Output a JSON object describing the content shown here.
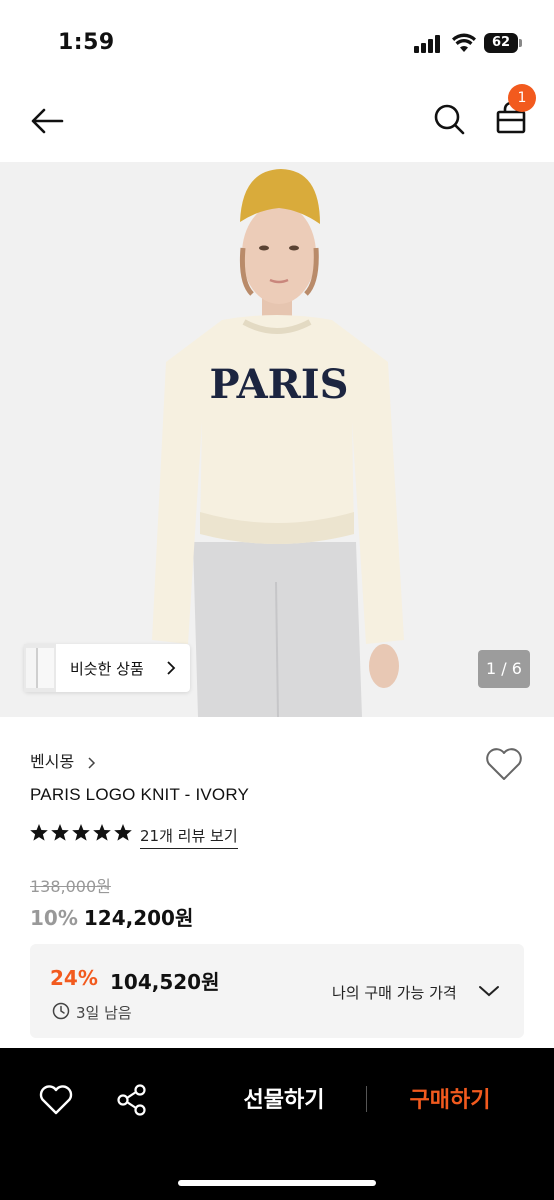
{
  "status_bar": {
    "time": "1:59",
    "battery": "62"
  },
  "nav": {
    "cart_count": "1"
  },
  "gallery": {
    "similar_label": "비슷한 상품",
    "page_indicator": "1 / 6",
    "hero_text": "PARIS"
  },
  "product": {
    "brand": "벤시몽",
    "title": "PARIS LOGO KNIT - IVORY",
    "rating_stars": 5,
    "review_link": "21개 리뷰 보기",
    "original_price": "138,000원",
    "discount_rate": "10%",
    "price": "124,200원"
  },
  "coupon": {
    "rate": "24%",
    "price": "104,520원",
    "time_left": "3일 남음",
    "my_price_label": "나의 구매 가능 가격"
  },
  "bottom_bar": {
    "gift_label": "선물하기",
    "buy_label": "구매하기"
  },
  "colors": {
    "accent": "#f25a1e",
    "bottom_bar": "#000000",
    "coupon_bg": "#f4f4f4"
  }
}
